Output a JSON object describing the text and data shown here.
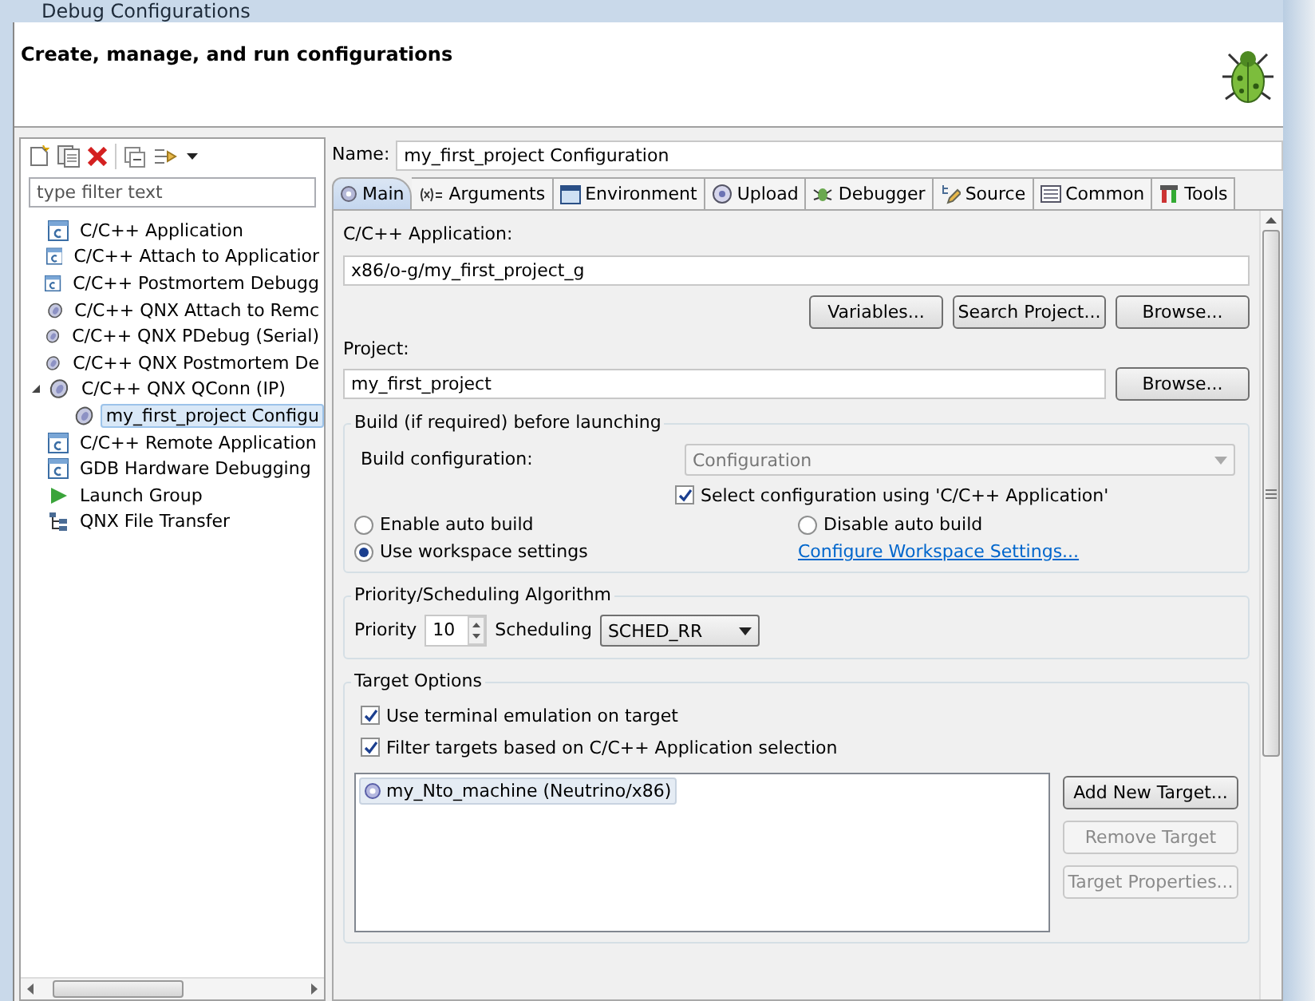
{
  "window": {
    "title": "Debug Configurations"
  },
  "header": {
    "title": "Create, manage, and run configurations"
  },
  "sidebar": {
    "filter": {
      "placeholder": "type filter text"
    },
    "items": [
      {
        "label": "C/C++ Application",
        "kind": "c",
        "selected": false
      },
      {
        "label": "C/C++ Attach to Applicatior",
        "kind": "c",
        "selected": false
      },
      {
        "label": "C/C++ Postmortem Debugg",
        "kind": "c",
        "selected": false
      },
      {
        "label": "C/C++ QNX Attach to Remc",
        "kind": "qnx",
        "selected": false
      },
      {
        "label": "C/C++ QNX PDebug (Serial)",
        "kind": "qnx",
        "selected": false
      },
      {
        "label": "C/C++ QNX Postmortem De",
        "kind": "qnx",
        "selected": false
      },
      {
        "label": "C/C++ QNX QConn (IP)",
        "kind": "qnx",
        "selected": false,
        "expanded": true,
        "children": [
          {
            "label": "my_first_project Configu",
            "kind": "qnx",
            "selected": true
          }
        ]
      },
      {
        "label": "C/C++ Remote Application",
        "kind": "c",
        "selected": false
      },
      {
        "label": "GDB Hardware Debugging",
        "kind": "c",
        "selected": false
      },
      {
        "label": "Launch Group",
        "kind": "launch",
        "selected": false
      },
      {
        "label": "QNX File Transfer",
        "kind": "transfer",
        "selected": false
      }
    ]
  },
  "name": {
    "label": "Name:",
    "value": "my_first_project Configuration"
  },
  "tabs": [
    {
      "label": "Main",
      "selected": true
    },
    {
      "label": "Arguments",
      "selected": false
    },
    {
      "label": "Environment",
      "selected": false
    },
    {
      "label": "Upload",
      "selected": false
    },
    {
      "label": "Debugger",
      "selected": false
    },
    {
      "label": "Source",
      "selected": false
    },
    {
      "label": "Common",
      "selected": false
    },
    {
      "label": "Tools",
      "selected": false
    }
  ],
  "main": {
    "app_label": "C/C++ Application:",
    "app_value": "x86/o-g/my_first_project_g",
    "app_buttons": [
      "Variables...",
      "Search Project...",
      "Browse..."
    ],
    "project_label": "Project:",
    "project_value": "my_first_project",
    "project_button": "Browse...",
    "build": {
      "title": "Build (if required) before launching",
      "config_label": "Build configuration:",
      "config_value": "Configuration",
      "select_config": {
        "label": "Select configuration using 'C/C++ Application'",
        "checked": true
      },
      "radios": [
        {
          "label": "Enable auto build",
          "selected": false
        },
        {
          "label": "Disable auto build",
          "selected": false
        },
        {
          "label": "Use workspace settings",
          "selected": true
        }
      ],
      "link": "Configure Workspace Settings..."
    },
    "priority": {
      "title": "Priority/Scheduling Algorithm",
      "priority_label": "Priority",
      "priority_value": "10",
      "scheduling_label": "Scheduling",
      "scheduling_value": "SCHED_RR"
    },
    "target": {
      "title": "Target Options",
      "checks": [
        {
          "label": "Use terminal emulation on target",
          "checked": true
        },
        {
          "label": "Filter targets based on C/C++ Application selection",
          "checked": true
        }
      ],
      "targets": [
        {
          "label": "my_Nto_machine (Neutrino/x86)",
          "selected": true
        }
      ],
      "buttons": [
        {
          "label": "Add New Target...",
          "disabled": false
        },
        {
          "label": "Remove Target",
          "disabled": true
        },
        {
          "label": "Target Properties...",
          "disabled": true
        }
      ]
    }
  }
}
